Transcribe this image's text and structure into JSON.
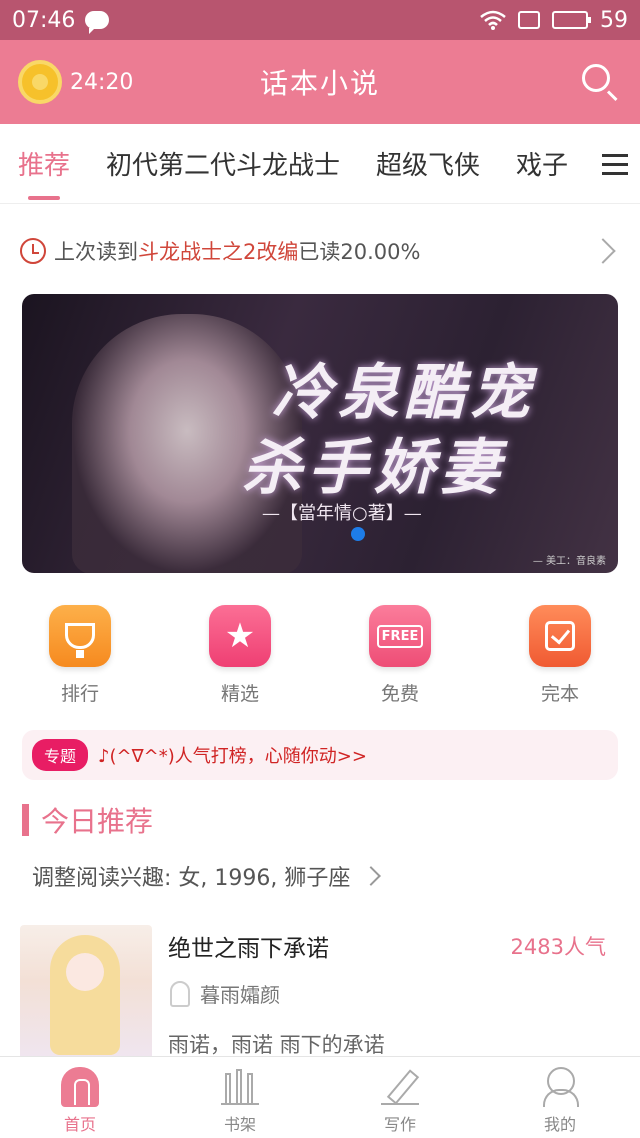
{
  "status_bar": {
    "time": "07:46",
    "battery": "59",
    "battery_level": 0.59
  },
  "header": {
    "timer": "24:20",
    "title": "话本小说"
  },
  "tabs": [
    {
      "label": "推荐",
      "active": true
    },
    {
      "label": "初代第二代斗龙战士",
      "active": false
    },
    {
      "label": "超级飞侠",
      "active": false
    },
    {
      "label": "戏子",
      "active": false
    }
  ],
  "last_read": {
    "prefix": "上次读到",
    "book": "斗龙战士之2改编",
    "progress": "已读20.00%"
  },
  "banner": {
    "title_line1": "冷泉酷宠",
    "title_line2": "杀手娇妻",
    "author": "—【當年情○著】—",
    "credit": "— 美工：音良素"
  },
  "quick_nav": [
    {
      "label": "排行",
      "icon": "trophy-icon"
    },
    {
      "label": "精选",
      "icon": "star-icon"
    },
    {
      "label": "免费",
      "icon": "free-tag-icon",
      "tag": "FREE"
    },
    {
      "label": "完本",
      "icon": "check-icon"
    }
  ],
  "topic": {
    "badge": "专题",
    "text": "♪(^∇^*)人气打榜，心随你动>>"
  },
  "section": {
    "title": "今日推荐"
  },
  "interest": {
    "text": "调整阅读兴趣: 女, 1996, 狮子座"
  },
  "book": {
    "title": "绝世之雨下承诺",
    "popularity": "2483人气",
    "author": "暮雨孀颜",
    "description": "雨诺，雨诺 雨下的承诺"
  },
  "bottom_nav": [
    {
      "label": "首页",
      "icon": "home-icon",
      "active": true
    },
    {
      "label": "书架",
      "icon": "bookshelf-icon",
      "active": false
    },
    {
      "label": "写作",
      "icon": "pen-icon",
      "active": false
    },
    {
      "label": "我的",
      "icon": "profile-icon",
      "active": false
    }
  ],
  "colors": {
    "accent": "#e8728c",
    "header_bg": "#ec7c93",
    "status_bg": "#b8556f",
    "highlight_red": "#d0463a",
    "topic_badge": "#e81d64"
  }
}
